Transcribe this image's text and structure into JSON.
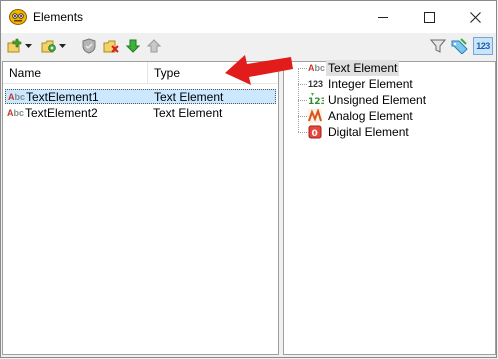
{
  "window": {
    "title": "Elements"
  },
  "search": {
    "value": "",
    "placeholder": ""
  },
  "table": {
    "columns": [
      "Name",
      "Type"
    ],
    "rows": [
      {
        "name": "TextElement1",
        "type": "Text Element",
        "selected": true
      },
      {
        "name": "TextElement2",
        "type": "Text Element",
        "selected": false
      }
    ]
  },
  "tree": {
    "items": [
      {
        "label": "Text Element",
        "icon": "text-element-icon"
      },
      {
        "label": "Integer Element",
        "icon": "integer-element-icon"
      },
      {
        "label": "Unsigned Element",
        "icon": "unsigned-element-icon"
      },
      {
        "label": "Analog Element",
        "icon": "analog-element-icon"
      },
      {
        "label": "Digital Element",
        "icon": "digital-element-icon"
      }
    ]
  },
  "icons": {
    "abc_a": "A",
    "abc_b": "bc",
    "num": "123"
  },
  "colors": {
    "selection": "#cce8ff",
    "arrow": "#e21b1b"
  }
}
